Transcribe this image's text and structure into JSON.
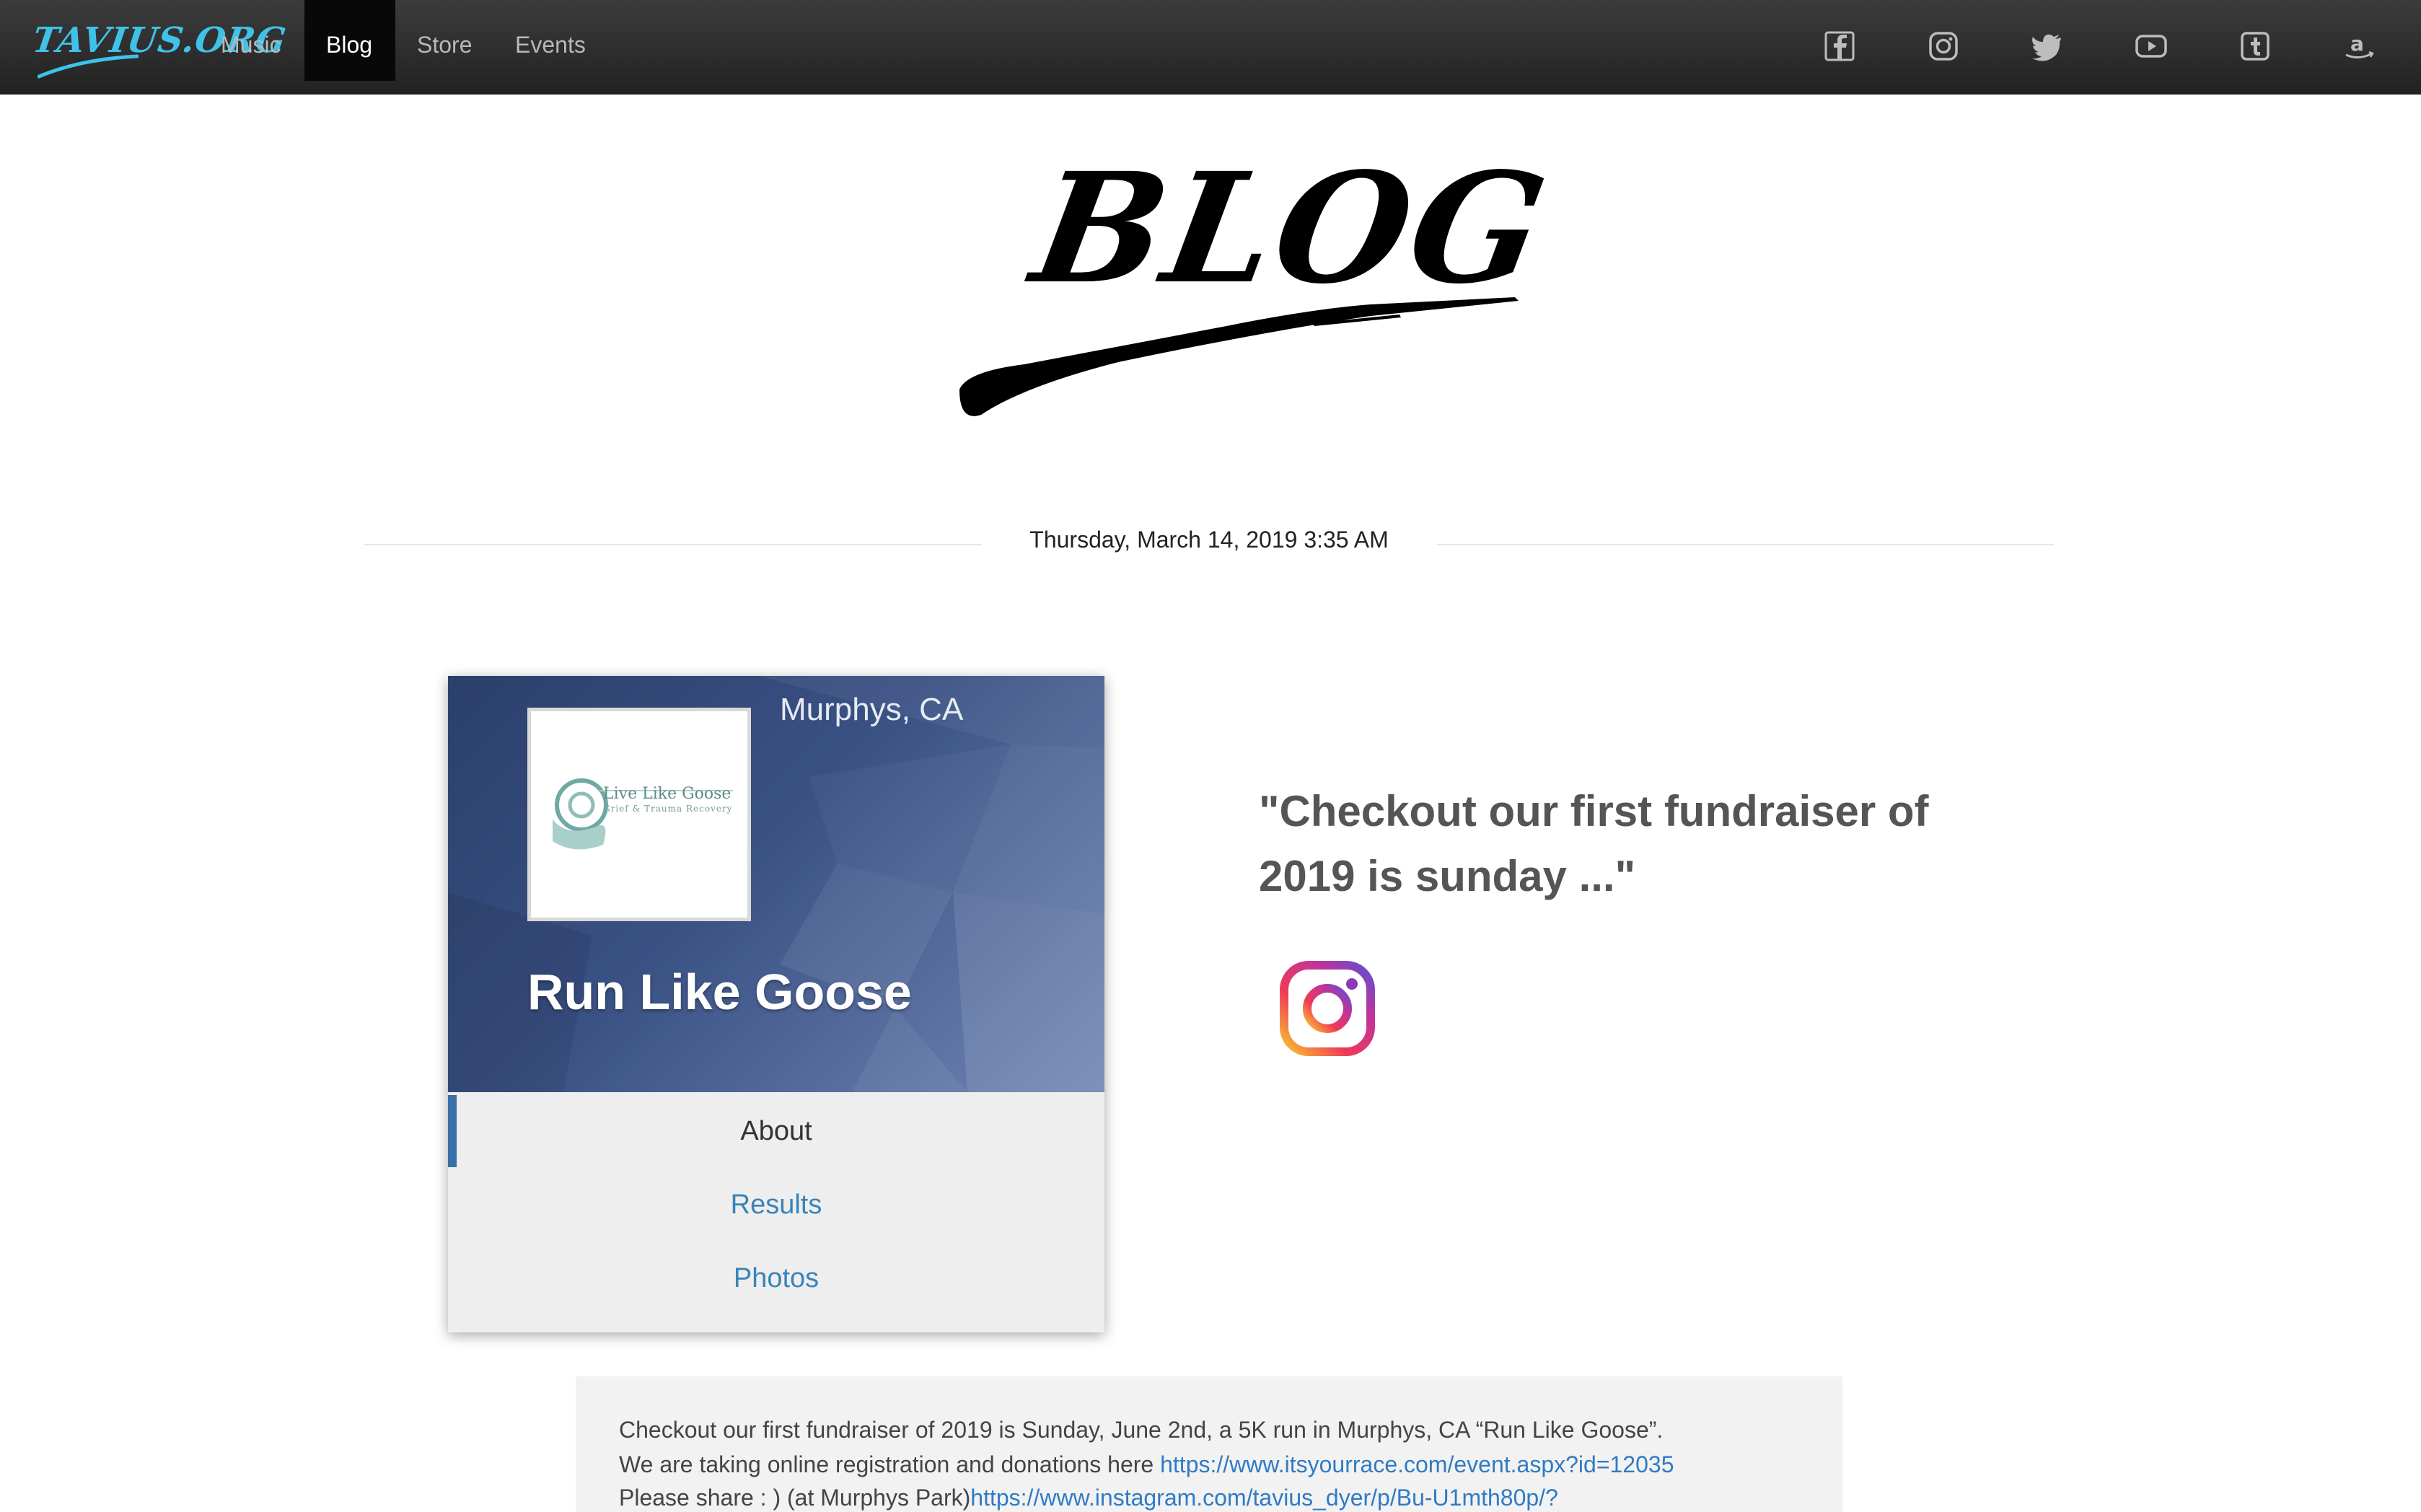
{
  "nav": {
    "brand": "TAVIUS.ORG",
    "items": [
      {
        "label": "Music",
        "active": false
      },
      {
        "label": "Blog",
        "active": true
      },
      {
        "label": "Store",
        "active": false
      },
      {
        "label": "Events",
        "active": false
      }
    ],
    "social_icons": [
      "facebook-icon",
      "instagram-icon",
      "twitter-icon",
      "youtube-icon",
      "tumblr-icon",
      "amazon-icon"
    ]
  },
  "page": {
    "heading": "BLOG"
  },
  "post": {
    "date": "Thursday, March 14, 2019 3:35 AM",
    "quote": "\"Checkout our first fundraiser of 2019 is sunday ...\"",
    "embed_card": {
      "location": "Murphys, CA",
      "logo_text": "Live Like Goose",
      "logo_subtext": "Grief & Trauma Recovery",
      "name": "Run Like Goose",
      "tabs": [
        "About",
        "Results",
        "Photos"
      ],
      "selected_tab": "About"
    },
    "caption": {
      "line1": "Checkout our first fundraiser of 2019 is Sunday, June 2nd, a 5K run in Murphys, CA “Run Like Goose”.",
      "line2_text": "We are taking online registration and donations here ",
      "line2_link": "https://www.itsyourrace.com/event.aspx?id=12035",
      "line3_text": "Please share : ) (at Murphys Park)",
      "line3_link": "https://www.instagram.com/tavius_dyer/p/Bu-U1mth80p/?"
    }
  },
  "colors": {
    "navbar": "#2c2c2c",
    "brand": "#3fc2e8",
    "link": "#2f7bc4",
    "quote": "#555555",
    "card_banner": "#3a5184"
  }
}
